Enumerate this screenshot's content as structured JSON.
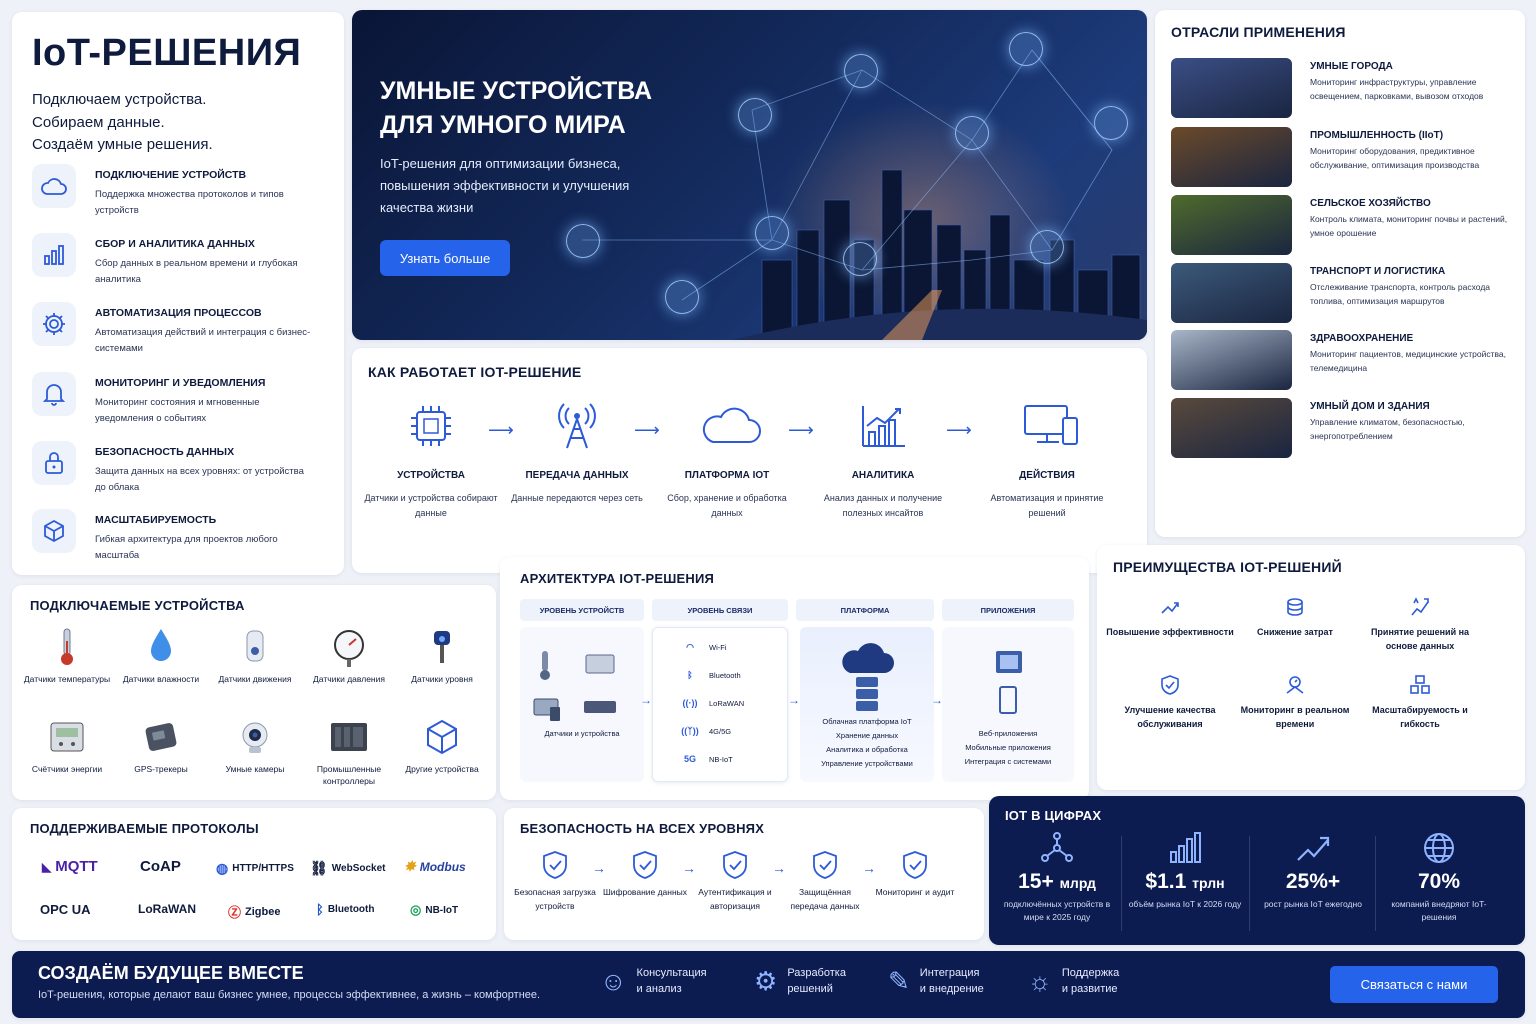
{
  "left": {
    "title": "IoT-РЕШЕНИЯ",
    "intro": [
      "Подключаем устройства.",
      "Собираем данные.",
      "Создаём умные решения."
    ],
    "features": [
      {
        "icon": "cloud-icon",
        "title": "ПОДКЛЮЧЕНИЕ УСТРОЙСТВ",
        "desc": "Поддержка множества протоколов и типов устройств"
      },
      {
        "icon": "bar-chart-icon",
        "title": "СБОР И АНАЛИТИКА ДАННЫХ",
        "desc": "Сбор данных в реальном времени и глубокая аналитика"
      },
      {
        "icon": "gear-icon",
        "title": "АВТОМАТИЗАЦИЯ ПРОЦЕССОВ",
        "desc": "Автоматизация действий и интеграция с бизнес-системами"
      },
      {
        "icon": "bell-icon",
        "title": "МОНИТОРИНГ И УВЕДОМЛЕНИЯ",
        "desc": "Мониторинг состояния и мгновенные уведомления о событиях"
      },
      {
        "icon": "lock-icon",
        "title": "БЕЗОПАСНОСТЬ ДАННЫХ",
        "desc": "Защита данных на всех уровнях: от устройства до облака"
      },
      {
        "icon": "cube-icon",
        "title": "МАСШТАБИРУЕМОСТЬ",
        "desc": "Гибкая архитектура для проектов любого масштаба"
      }
    ]
  },
  "hero": {
    "title_line1": "УМНЫЕ УСТРОЙСТВА",
    "title_line2": "ДЛЯ УМНОГО МИРА",
    "subtitle": "IoT-решения для оптимизации бизнеса, повышения эффективности и улучшения качества жизни",
    "button": "Узнать больше"
  },
  "how": {
    "title": "КАК РАБОТАЕТ IOT-РЕШЕНИЕ",
    "steps": [
      {
        "icon": "chip-icon",
        "title": "УСТРОЙСТВА",
        "desc": "Датчики и устройства собирают данные"
      },
      {
        "icon": "antenna-icon",
        "title": "ПЕРЕДАЧА ДАННЫХ",
        "desc": "Данные передаются через сеть"
      },
      {
        "icon": "cloud-icon",
        "title": "ПЛАТФОРМА IOT",
        "desc": "Сбор, хранение и обработка данных"
      },
      {
        "icon": "analytics-icon",
        "title": "АНАЛИТИКА",
        "desc": "Анализ данных и получение полезных инсайтов"
      },
      {
        "icon": "devices-icon",
        "title": "ДЕЙСТВИЯ",
        "desc": "Автоматизация и принятие решений"
      }
    ]
  },
  "industries": {
    "title": "ОТРАСЛИ ПРИМЕНЕНИЯ",
    "items": [
      {
        "title": "УМНЫЕ ГОРОДА",
        "desc": "Мониторинг инфраструктуры, управление освещением, парковками, вывозом отходов",
        "color": "#3b4f86"
      },
      {
        "title": "ПРОМЫШЛЕННОСТЬ (IIoT)",
        "desc": "Мониторинг оборудования, предиктивное обслуживание, оптимизация производства",
        "color": "#6b4a2a"
      },
      {
        "title": "СЕЛЬСКОЕ ХОЗЯЙСТВО",
        "desc": "Контроль климата, мониторинг почвы и растений, умное орошение",
        "color": "#4f6b2c"
      },
      {
        "title": "ТРАНСПОРТ И ЛОГИСТИКА",
        "desc": "Отслеживание транспорта, контроль расхода топлива, оптимизация маршрутов",
        "color": "#3c5a7a"
      },
      {
        "title": "ЗДРАВООХРАНЕНИЕ",
        "desc": "Мониторинг пациентов, медицинские устройства, телемедицина",
        "color": "#a8b6c8"
      },
      {
        "title": "УМНЫЙ ДОМ И ЗДАНИЯ",
        "desc": "Управление климатом, безопасностью, энергопотреблением",
        "color": "#5a4a3c"
      }
    ]
  },
  "devices": {
    "title": "ПОДКЛЮЧАЕМЫЕ УСТРОЙСТВА",
    "items": [
      {
        "icon": "thermometer-icon",
        "label": "Датчики температуры"
      },
      {
        "icon": "water-drop-icon",
        "label": "Датчики влажности"
      },
      {
        "icon": "motion-sensor-icon",
        "label": "Датчики движения"
      },
      {
        "icon": "pressure-gauge-icon",
        "label": "Датчики давления"
      },
      {
        "icon": "level-sensor-icon",
        "label": "Датчики уровня"
      },
      {
        "icon": "energy-meter-icon",
        "label": "Счётчики энергии"
      },
      {
        "icon": "gps-tracker-icon",
        "label": "GPS-трекеры"
      },
      {
        "icon": "camera-icon",
        "label": "Умные камеры"
      },
      {
        "icon": "controller-icon",
        "label": "Промышленные контроллеры"
      },
      {
        "icon": "cube-icon",
        "label": "Другие устройства"
      }
    ]
  },
  "architecture": {
    "title": "АРХИТЕКТУРА IOT-РЕШЕНИЯ",
    "columns": [
      "УРОВЕНЬ УСТРОЙСТВ",
      "УРОВЕНЬ СВЯЗИ",
      "ПЛАТФОРМА",
      "ПРИЛОЖЕНИЯ"
    ],
    "devices_label": "Датчики и устройства",
    "connections": [
      {
        "icon": "wifi-icon",
        "label": "Wi-Fi"
      },
      {
        "icon": "bluetooth-icon",
        "label": "Bluetooth"
      },
      {
        "icon": "lorawan-icon",
        "label": "LoRaWAN"
      },
      {
        "icon": "4g-icon",
        "label": "4G/5G"
      },
      {
        "icon": "5g-icon",
        "label": "NB-IoT"
      }
    ],
    "platform_lines": [
      "Облачная платформа IoT",
      "Хранение данных",
      "Аналитика и обработка",
      "Управление устройствами"
    ],
    "apps_lines": [
      "Веб-приложения",
      "Мобильные приложения",
      "Интеграция с системами"
    ]
  },
  "benefits": {
    "title": "ПРЕИМУЩЕСТВА IOT-РЕШЕНИЙ",
    "items": [
      {
        "icon": "efficiency-icon",
        "label": "Повышение эффективности"
      },
      {
        "icon": "coins-icon",
        "label": "Снижение затрат"
      },
      {
        "icon": "decision-icon",
        "label": "Принятие решений на основе данных"
      },
      {
        "icon": "shield-check-icon",
        "label": "Улучшение качества обслуживания"
      },
      {
        "icon": "monitor-icon",
        "label": "Мониторинг в реальном времени"
      },
      {
        "icon": "scale-icon",
        "label": "Масштабируемость и гибкость"
      }
    ]
  },
  "protocols": {
    "title": "ПОДДЕРЖИВАЕМЫЕ ПРОТОКОЛЫ",
    "row1": [
      "MQTT",
      "CoAP",
      "HTTP/HTTPS",
      "WebSocket",
      "Modbus"
    ],
    "row2": [
      "OPC UA",
      "LoRaWAN",
      "Zigbee",
      "Bluetooth",
      "NB-IoT"
    ]
  },
  "security": {
    "title": "БЕЗОПАСНОСТЬ НА ВСЕХ УРОВНЯХ",
    "items": [
      "Безопасная загрузка устройств",
      "Шифрование данных",
      "Аутентификация и авторизация",
      "Защищённая передача данных",
      "Мониторинг и аудит"
    ]
  },
  "stats": {
    "title": "IOT В ЦИФРАХ",
    "items": [
      {
        "icon": "network-icon",
        "value": "15+",
        "unit": "млрд",
        "label": "подключённых устройств в мире к 2025 году"
      },
      {
        "icon": "bar-chart-icon",
        "value": "$1.1",
        "unit": "трлн",
        "label": "объём рынка IoT к 2026 году"
      },
      {
        "icon": "trend-up-icon",
        "value": "25%+",
        "unit": "",
        "label": "рост рынка IoT ежегодно"
      },
      {
        "icon": "globe-icon",
        "value": "70%",
        "unit": "",
        "label": "компаний внедряют IoT-решения"
      }
    ]
  },
  "footer": {
    "title": "СОЗДАЁМ БУДУЩЕЕ ВМЕСТЕ",
    "subtitle": "IoT-решения, которые делают ваш бизнес умнее, процессы эффективнее, а жизнь – комфортнее.",
    "services": [
      {
        "icon": "consult-icon",
        "line1": "Консультация",
        "line2": "и анализ"
      },
      {
        "icon": "develop-icon",
        "line1": "Разработка",
        "line2": "решений"
      },
      {
        "icon": "integration-icon",
        "line1": "Интеграция",
        "line2": "и внедрение"
      },
      {
        "icon": "support-icon",
        "line1": "Поддержка",
        "line2": "и развитие"
      }
    ],
    "button": "Связаться с нами"
  }
}
